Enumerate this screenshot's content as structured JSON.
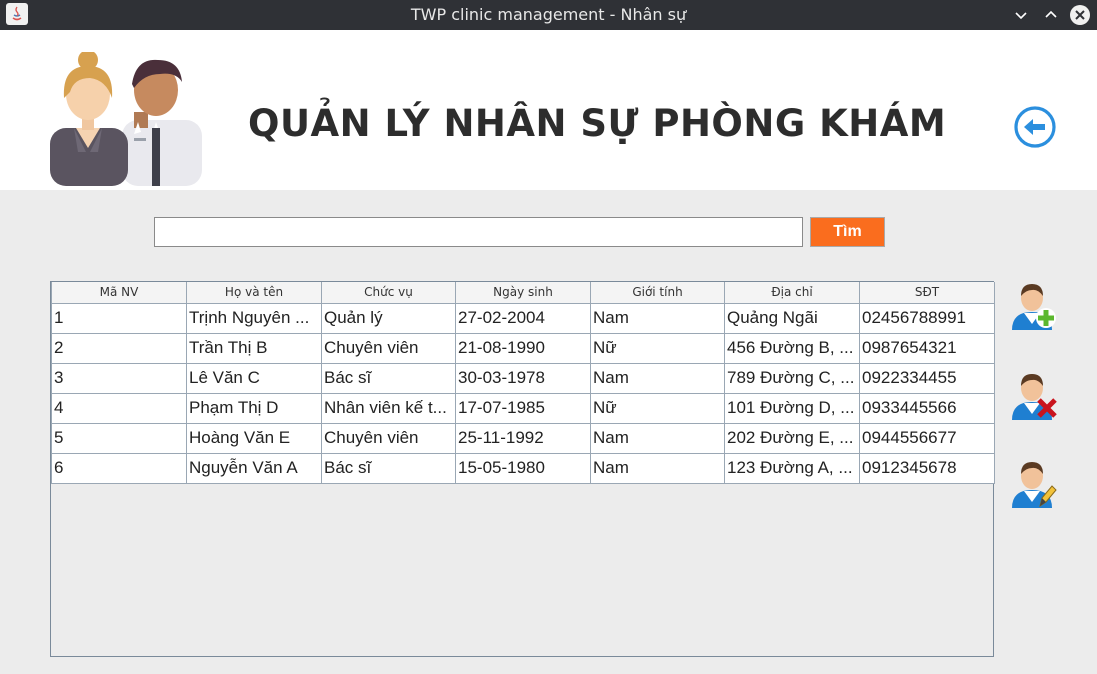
{
  "window": {
    "title": "TWP clinic management - Nhân sự",
    "controls": [
      "chevron-down-icon",
      "chevron-up-icon",
      "close-icon"
    ]
  },
  "header": {
    "title": "QUẢN LÝ NHÂN SỰ PHÒNG KHÁM",
    "back_icon": "back-arrow-icon",
    "accent": "#2b8fde"
  },
  "search": {
    "value": "",
    "placeholder": "",
    "button_label": "Tìm",
    "button_color": "#fa6d1e"
  },
  "table": {
    "columns": [
      "Mã NV",
      "Họ và tên",
      "Chức vụ",
      "Ngày sinh",
      "Giới tính",
      "Địa chỉ",
      "SĐT"
    ],
    "rows": [
      [
        "1",
        "Trịnh Nguyên ...",
        "Quản lý",
        "27-02-2004",
        "Nam",
        "Quảng Ngãi",
        "02456788991"
      ],
      [
        "2",
        "Trần Thị B",
        "Chuyên viên",
        "21-08-1990",
        "Nữ",
        "456 Đường B, ...",
        "0987654321"
      ],
      [
        "3",
        "Lê Văn C",
        "Bác sĩ",
        "30-03-1978",
        "Nam",
        "789 Đường C, ...",
        "0922334455"
      ],
      [
        "4",
        "Phạm Thị D",
        "Nhân viên kế t...",
        "17-07-1985",
        "Nữ",
        "101 Đường D, ...",
        "0933445566"
      ],
      [
        "5",
        "Hoàng Văn E",
        "Chuyên viên",
        "25-11-1992",
        "Nam",
        "202 Đường E, ...",
        "0944556677"
      ],
      [
        "6",
        "Nguyễn Văn A",
        "Bác sĩ",
        "15-05-1980",
        "Nam",
        "123 Đường A, ...",
        "0912345678"
      ]
    ]
  },
  "actions": [
    {
      "name": "add-user-button",
      "icon": "user-add-icon"
    },
    {
      "name": "delete-user-button",
      "icon": "user-delete-icon"
    },
    {
      "name": "edit-user-button",
      "icon": "user-edit-icon"
    }
  ]
}
